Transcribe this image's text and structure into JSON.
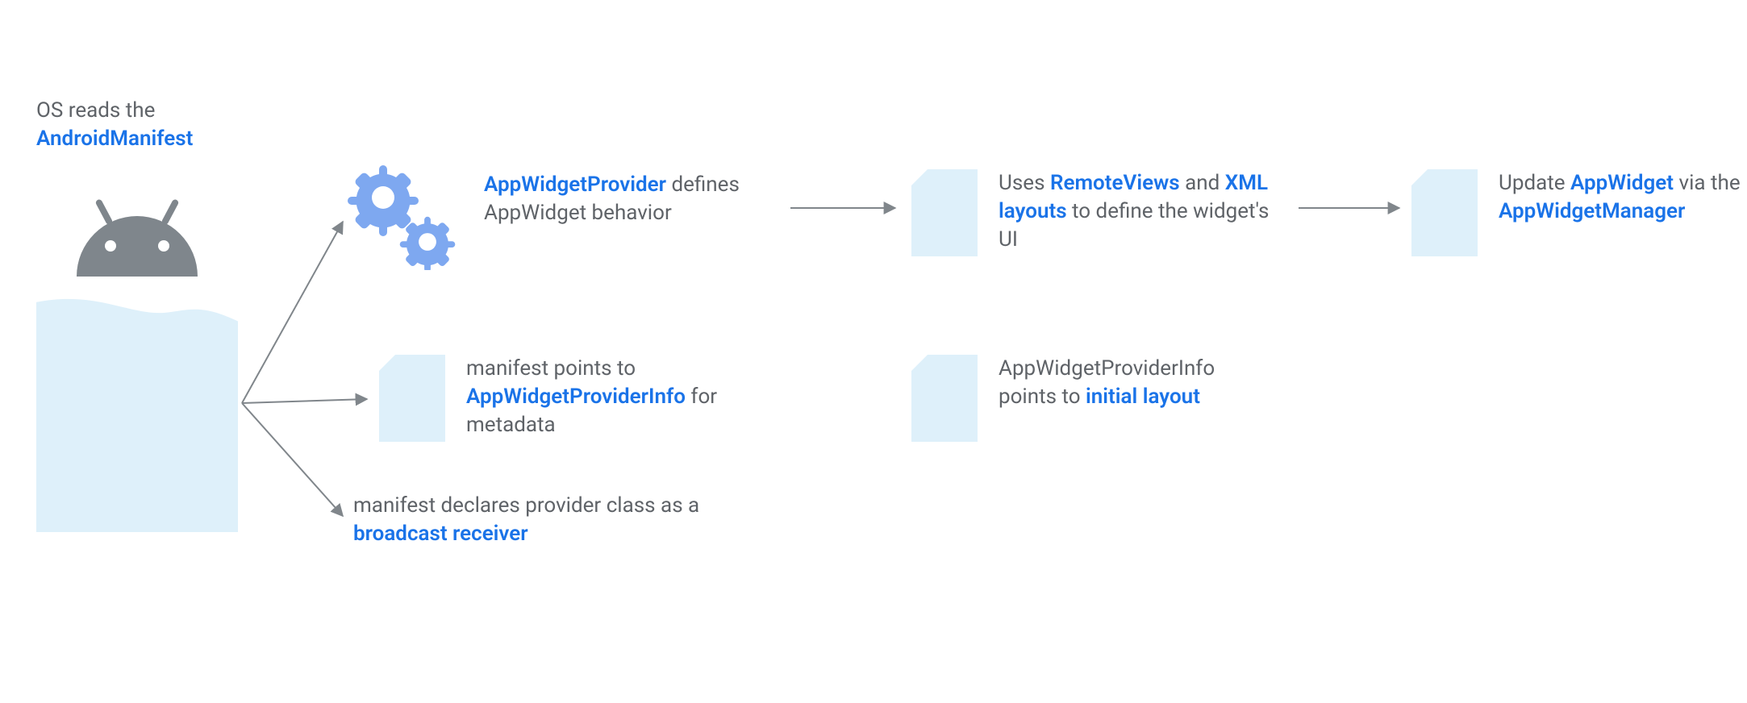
{
  "header": {
    "pre": "OS reads the",
    "bold": "AndroidManifest"
  },
  "nodes": {
    "provider": {
      "bold": "AppWidgetProvider",
      "rest": "defines AppWidget behavior"
    },
    "info": {
      "pre": "manifest points to ",
      "bold": "AppWidgetProviderInfo",
      "post": " for metadata"
    },
    "broadcast": {
      "pre": "manifest declares provider class as a ",
      "bold": "broadcast receiver"
    },
    "remote": {
      "pre": "Uses ",
      "b1": "RemoteViews",
      "mid": " and ",
      "b2": "XML layouts",
      "post": " to define the widget's UI"
    },
    "initial": {
      "pre": "AppWidgetProviderInfo points to ",
      "bold": "initial layout"
    },
    "update": {
      "pre": "Update ",
      "b1": "AppWidget",
      "mid": " via the ",
      "b2": "AppWidgetManager"
    }
  }
}
